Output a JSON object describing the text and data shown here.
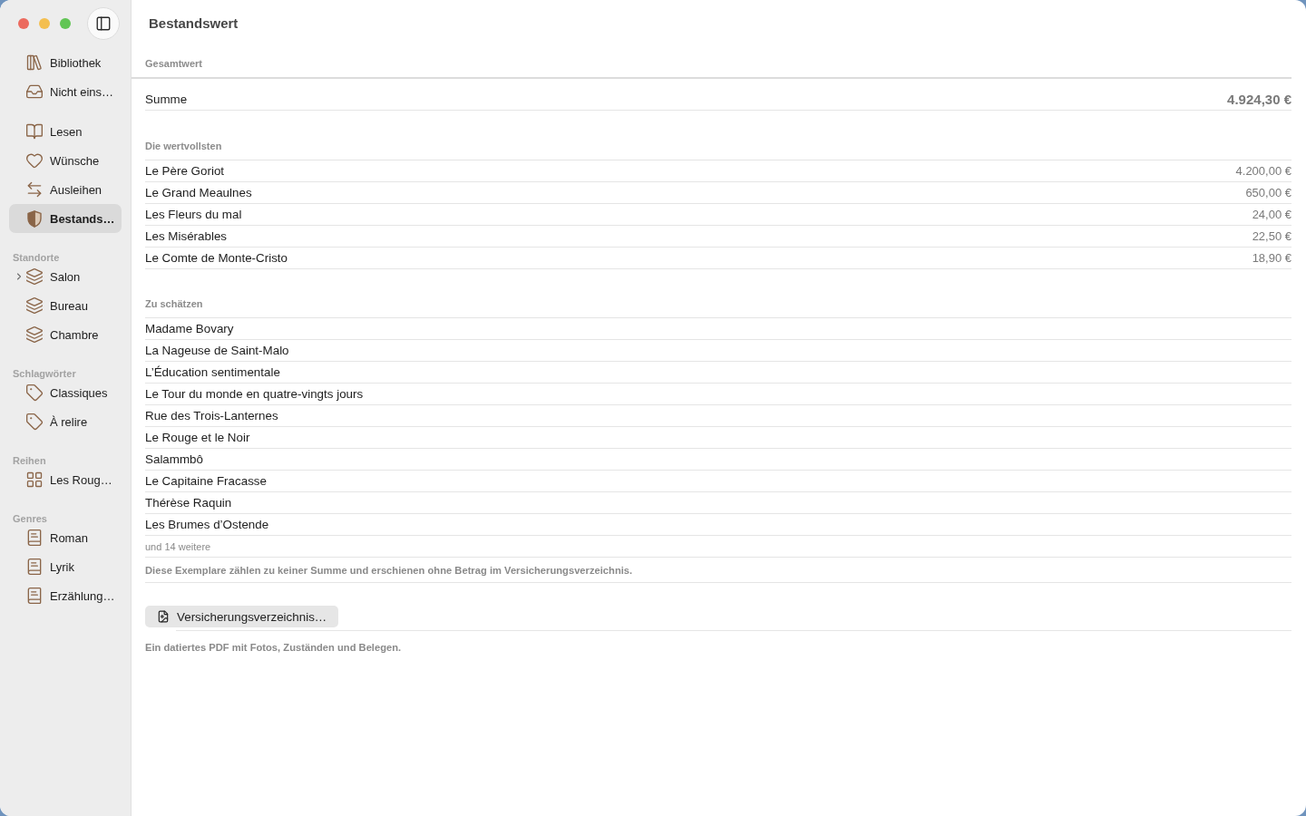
{
  "sidebar": {
    "groups": [
      {
        "items": [
          {
            "label": "Bibliothek",
            "kind": "books",
            "selected": false
          },
          {
            "label": "Nicht eins…",
            "kind": "tray",
            "selected": false
          }
        ]
      },
      {
        "items": [
          {
            "label": "Lesen",
            "kind": "open-book",
            "selected": false
          },
          {
            "label": "Wünsche",
            "kind": "heart",
            "selected": false
          },
          {
            "label": "Ausleihen",
            "kind": "swap",
            "selected": false
          },
          {
            "label": "Bestands…",
            "kind": "shield",
            "selected": true
          }
        ]
      },
      {
        "title": "Standorte",
        "items": [
          {
            "label": "Salon",
            "kind": "layers",
            "selected": false,
            "expandable": true,
            "expanded": false
          },
          {
            "label": "Bureau",
            "kind": "layers",
            "selected": false,
            "expandable": false
          },
          {
            "label": "Chambre",
            "kind": "layers",
            "selected": false,
            "expandable": false
          }
        ]
      },
      {
        "title": "Schlagwörter",
        "items": [
          {
            "label": "Classiques",
            "kind": "tag",
            "selected": false
          },
          {
            "label": "À relire",
            "kind": "tag",
            "selected": false
          }
        ]
      },
      {
        "title": "Reihen",
        "items": [
          {
            "label": "Les Roug…",
            "kind": "grid",
            "selected": false
          }
        ]
      },
      {
        "title": "Genres",
        "items": [
          {
            "label": "Roman",
            "kind": "book",
            "selected": false
          },
          {
            "label": "Lyrik",
            "kind": "book",
            "selected": false
          },
          {
            "label": "Erzählung…",
            "kind": "book",
            "selected": false
          }
        ]
      }
    ]
  },
  "title": "Bestandswert",
  "total": {
    "heading": "Gesamtwert",
    "label": "Summe",
    "value": "4.924,30 €"
  },
  "most_valuable": {
    "heading": "Die wertvollsten",
    "rows": [
      {
        "title": "Le Père Goriot",
        "value": "4.200,00 €"
      },
      {
        "title": "Le Grand Meaulnes",
        "value": "650,00 €"
      },
      {
        "title": "Les Fleurs du mal",
        "value": "24,00 €"
      },
      {
        "title": "Les Misérables",
        "value": "22,50 €"
      },
      {
        "title": "Le Comte de Monte-Cristo",
        "value": "18,90 €"
      }
    ]
  },
  "to_estimate": {
    "heading": "Zu schätzen",
    "rows": [
      {
        "title": "Madame Bovary"
      },
      {
        "title": "La Nageuse de Saint-Malo"
      },
      {
        "title": "L’Éducation sentimentale"
      },
      {
        "title": "Le Tour du monde en quatre-vingts jours"
      },
      {
        "title": "Rue des Trois-Lanternes"
      },
      {
        "title": "Le Rouge et le Noir"
      },
      {
        "title": "Salammbô"
      },
      {
        "title": "Le Capitaine Fracasse"
      },
      {
        "title": "Thérèse Raquin"
      },
      {
        "title": "Les Brumes d’Ostende"
      }
    ],
    "more": "und 14 weitere",
    "note": "Diese Exemplare zählen zu keiner Summe und erschienen ohne Betrag im Versicherungsverzeichnis."
  },
  "export": {
    "button": "Versicherungsverzeichnis…",
    "note": "Ein datiertes PDF mit Fotos, Zuständen und Belegen."
  }
}
